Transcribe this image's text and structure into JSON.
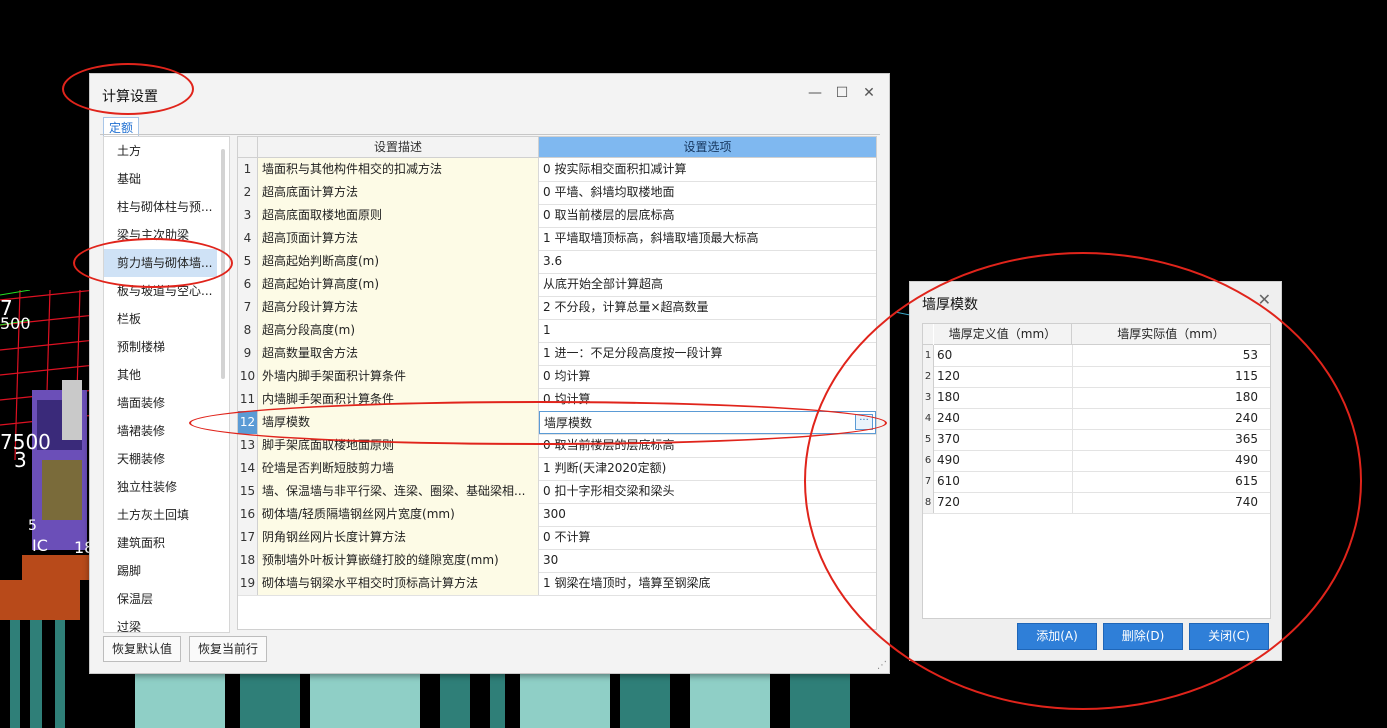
{
  "scene": {
    "labels": [
      "7",
      "500",
      "7500",
      "3",
      "5",
      "IC",
      "18"
    ]
  },
  "dialog": {
    "title": "计算设置",
    "tab": "定额",
    "categories": [
      "土方",
      "基础",
      "柱与砌体柱与预...",
      "梁与主次肋梁",
      "剪力墙与砌体墙...",
      "板与坡道与空心...",
      "栏板",
      "预制楼梯",
      "其他",
      "墙面装修",
      "墙裙装修",
      "天棚装修",
      "独立柱装修",
      "土方灰土回填",
      "建筑面积",
      "踢脚",
      "保温层",
      "过梁"
    ],
    "selected_category_index": 4,
    "columns": {
      "desc": "设置描述",
      "opt": "设置选项"
    },
    "rows": [
      {
        "n": "1",
        "d": "墙面积与其他构件相交的扣减方法",
        "o": "0 按实际相交面积扣减计算"
      },
      {
        "n": "2",
        "d": "超高底面计算方法",
        "o": "0 平墙、斜墙均取楼地面"
      },
      {
        "n": "3",
        "d": "超高底面取楼地面原则",
        "o": "0 取当前楼层的层底标高"
      },
      {
        "n": "4",
        "d": "超高顶面计算方法",
        "o": "1 平墙取墙顶标高，斜墙取墙顶最大标高"
      },
      {
        "n": "5",
        "d": "超高起始判断高度(m)",
        "o": "3.6"
      },
      {
        "n": "6",
        "d": "超高起始计算高度(m)",
        "o": "从底开始全部计算超高"
      },
      {
        "n": "7",
        "d": "超高分段计算方法",
        "o": "2 不分段，计算总量×超高数量"
      },
      {
        "n": "8",
        "d": "超高分段高度(m)",
        "o": "1"
      },
      {
        "n": "9",
        "d": "超高数量取舍方法",
        "o": "1 进一：不足分段高度按一段计算"
      },
      {
        "n": "10",
        "d": "外墙内脚手架面积计算条件",
        "o": "0 均计算"
      },
      {
        "n": "11",
        "d": "内墙脚手架面积计算条件",
        "o": "0 均计算"
      },
      {
        "n": "12",
        "d": "墙厚模数",
        "o": "墙厚模数"
      },
      {
        "n": "13",
        "d": "脚手架底面取楼地面原则",
        "o": "0 取当前楼层的层底标高"
      },
      {
        "n": "14",
        "d": "砼墙是否判断短肢剪力墙",
        "o": "1 判断(天津2020定额)"
      },
      {
        "n": "15",
        "d": "墙、保温墙与非平行梁、连梁、圈梁、基础梁相...",
        "o": "0 扣十字形相交梁和梁头"
      },
      {
        "n": "16",
        "d": "砌体墙/轻质隔墙钢丝网片宽度(mm)",
        "o": "300"
      },
      {
        "n": "17",
        "d": "阴角钢丝网片长度计算方法",
        "o": "0 不计算"
      },
      {
        "n": "18",
        "d": "预制墙外叶板计算嵌缝打胶的缝隙宽度(mm)",
        "o": "30"
      },
      {
        "n": "19",
        "d": "砌体墙与钢梁水平相交时顶标高计算方法",
        "o": "1 钢梁在墙顶时，墙算至钢梁底"
      }
    ],
    "active_row_index": 11,
    "buttons": {
      "restore_default": "恢复默认值",
      "restore_current": "恢复当前行"
    }
  },
  "thickness_dialog": {
    "title": "墙厚模数",
    "columns": {
      "defined": "墙厚定义值（mm）",
      "actual": "墙厚实际值（mm）"
    },
    "rows": [
      {
        "n": "1",
        "a": "60",
        "b": "53"
      },
      {
        "n": "2",
        "a": "120",
        "b": "115"
      },
      {
        "n": "3",
        "a": "180",
        "b": "180"
      },
      {
        "n": "4",
        "a": "240",
        "b": "240"
      },
      {
        "n": "5",
        "a": "370",
        "b": "365"
      },
      {
        "n": "6",
        "a": "490",
        "b": "490"
      },
      {
        "n": "7",
        "a": "610",
        "b": "615"
      },
      {
        "n": "8",
        "a": "720",
        "b": "740"
      }
    ],
    "buttons": {
      "add": "添加(A)",
      "delete": "删除(D)",
      "close": "关闭(C)"
    }
  },
  "colors": {
    "accent": "#2f7fd8",
    "header_selected": "#7fb8f0",
    "annotation": "#e0241b"
  }
}
